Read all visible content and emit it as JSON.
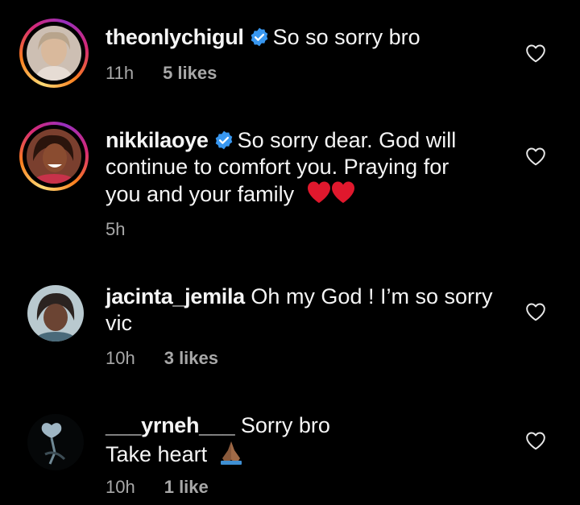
{
  "comments": [
    {
      "username": "theonlychigul",
      "verified": true,
      "text": "So so sorry bro",
      "time": "11h",
      "likes": "5 likes"
    },
    {
      "username": "nikkilaoye",
      "verified": true,
      "text_line1": "So sorry dear. God will",
      "text_line2": "continue to comfort you. Praying for",
      "text_line3": "you and your family",
      "time": "5h"
    },
    {
      "username": "jacinta_jemila",
      "verified": false,
      "text_line1": "Oh my God ! I’m so sorry",
      "text_line2": "vic",
      "time": "10h",
      "likes": "3 likes"
    },
    {
      "username": "___yrneh___",
      "verified": false,
      "text_line1": "Sorry bro",
      "text_line2": "Take heart",
      "time": "10h",
      "likes": "1 like"
    }
  ],
  "colors": {
    "background": "#000000",
    "text": "#f5f5f5",
    "meta": "#a8a8a8",
    "verified": "#3897f0",
    "emoji_heart": "#e0182d"
  },
  "icons": [
    "verified-badge-icon",
    "like-heart-icon",
    "red-heart-emoji",
    "praying-hands-emoji"
  ]
}
